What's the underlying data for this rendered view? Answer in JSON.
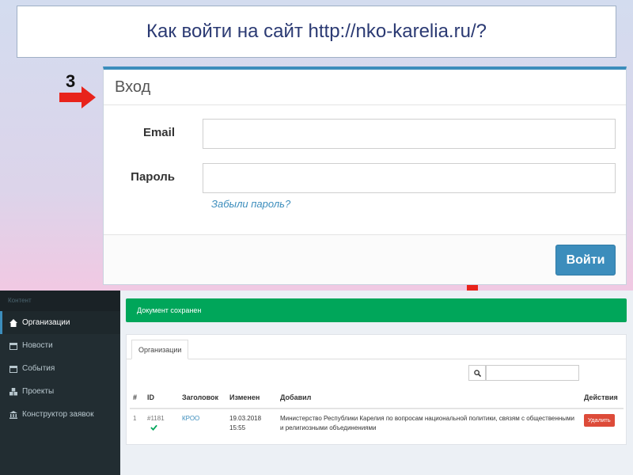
{
  "slide": {
    "title": "Как войти на сайт http://nko-karelia.ru/?",
    "step_number": "3"
  },
  "login": {
    "heading": "Вход",
    "email_label": "Email",
    "email_value": "",
    "password_label": "Пароль",
    "password_value": "",
    "forgot_link": "Забыли пароль?",
    "submit_label": "Войти"
  },
  "admin": {
    "sidebar": {
      "header": "Контент",
      "items": [
        {
          "label": "Организации",
          "icon": "home-icon",
          "active": true
        },
        {
          "label": "Новости",
          "icon": "calendar-icon",
          "active": false
        },
        {
          "label": "События",
          "icon": "calendar-icon",
          "active": false
        },
        {
          "label": "Проекты",
          "icon": "cubes-icon",
          "active": false
        },
        {
          "label": "Конструктор заявок",
          "icon": "bank-icon",
          "active": false
        }
      ]
    },
    "alert": "Документ сохранен",
    "tab_label": "Организации",
    "search_value": "",
    "table": {
      "columns": [
        "#",
        "ID",
        "Заголовок",
        "Изменен",
        "Добавил",
        "Действия"
      ],
      "rows": [
        {
          "num": "1",
          "id": "#1181",
          "title": "КРОО",
          "modified": "19.03.2018 15:55",
          "added_by": "Министерство Республики Карелия по вопросам национальной политики, связям с общественными и религиозными объединениями",
          "action": "Удалить"
        }
      ]
    }
  },
  "colors": {
    "accent": "#3c8dbc",
    "success": "#00a65a",
    "danger": "#dd4b39",
    "sidebar": "#222d32",
    "arrow": "#e8231b"
  }
}
